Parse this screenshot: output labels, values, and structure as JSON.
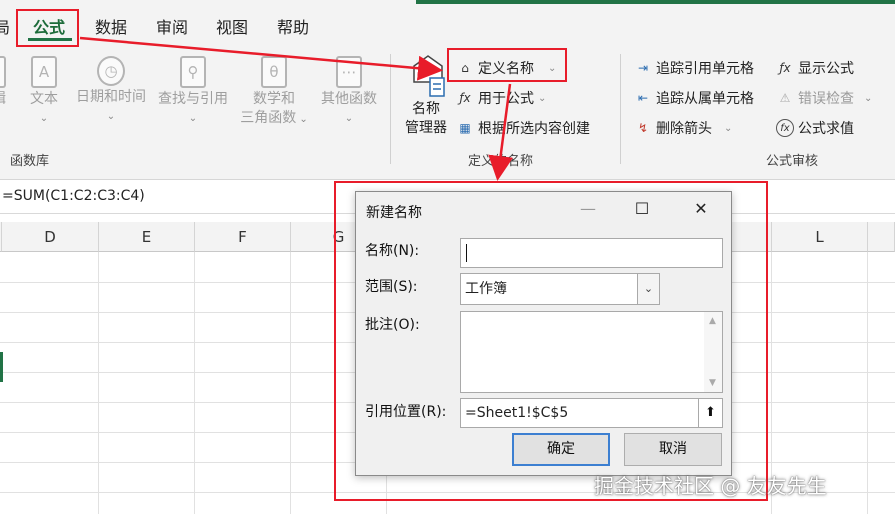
{
  "tabs": [
    {
      "label": "局"
    },
    {
      "label": "公式"
    },
    {
      "label": "数据"
    },
    {
      "label": "审阅"
    },
    {
      "label": "视图"
    },
    {
      "label": "帮助"
    }
  ],
  "ribbon": {
    "function_library": {
      "buttons": [
        {
          "label": "辑"
        },
        {
          "label": "文本"
        },
        {
          "label": "日期和时间"
        },
        {
          "label": "查找与引用"
        },
        {
          "label": "数学和",
          "label2": "三角函数"
        },
        {
          "label": "其他函数"
        }
      ],
      "group_label": "函数库"
    },
    "defined_names": {
      "name_manager_line1": "名称",
      "name_manager_line2": "管理器",
      "define_name": "定义名称",
      "use_in_formula": "用于公式",
      "create_from_selection": "根据所选内容创建",
      "group_label": "定义的名称"
    },
    "formula_auditing": {
      "trace_precedents": "追踪引用单元格",
      "trace_dependents": "追踪从属单元格",
      "remove_arrows": "删除箭头",
      "show_formulas": "显示公式",
      "error_checking": "错误检查",
      "evaluate_formula": "公式求值",
      "group_label": "公式审核"
    }
  },
  "formula_bar": {
    "text": "=SUM(C1:C2:C3:C4)"
  },
  "grid": {
    "columns": [
      "D",
      "E",
      "F",
      "G",
      "L"
    ]
  },
  "dialog": {
    "title": "新建名称",
    "name_label": "名称(N):",
    "name_value": "",
    "scope_label": "范围(S):",
    "scope_value": "工作簿",
    "comment_label": "批注(O):",
    "comment_value": "",
    "refers_to_label": "引用位置(R):",
    "refers_to_value": "=Sheet1!$C$5",
    "ok_label": "确定",
    "cancel_label": "取消",
    "minimize_glyph": "—",
    "maximize_glyph": "☐",
    "close_glyph": "✕"
  },
  "watermark": "掘金技术社区 @ 友友先生",
  "colors": {
    "excel_green": "#217346",
    "annotation_red": "#e81c2a",
    "focus_blue": "#3c7fd1"
  }
}
